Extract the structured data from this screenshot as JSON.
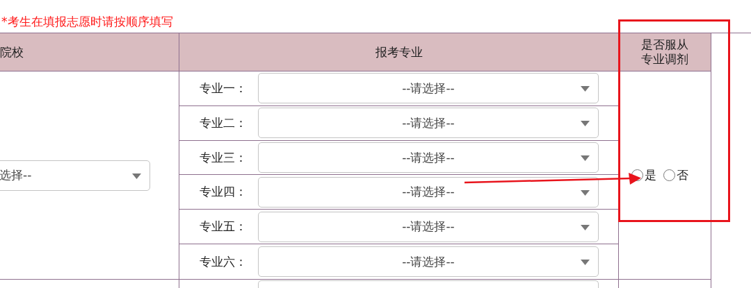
{
  "note": "*考生在填报志愿时请按顺序填写",
  "columns": [
    "院校",
    "报考专业",
    "是否服从专业调剂"
  ],
  "school": {
    "value": "选择--"
  },
  "majors": [
    {
      "label": "专业一：",
      "value": "--请选择--"
    },
    {
      "label": "专业二：",
      "value": "--请选择--"
    },
    {
      "label": "专业三：",
      "value": "--请选择--"
    },
    {
      "label": "专业四：",
      "value": "--请选择--"
    },
    {
      "label": "专业五：",
      "value": "--请选择--"
    },
    {
      "label": "专业六：",
      "value": "--请选择--"
    }
  ],
  "adjustment": {
    "options": [
      {
        "label": "是",
        "selected": false
      },
      {
        "label": "否",
        "selected": false
      }
    ]
  }
}
